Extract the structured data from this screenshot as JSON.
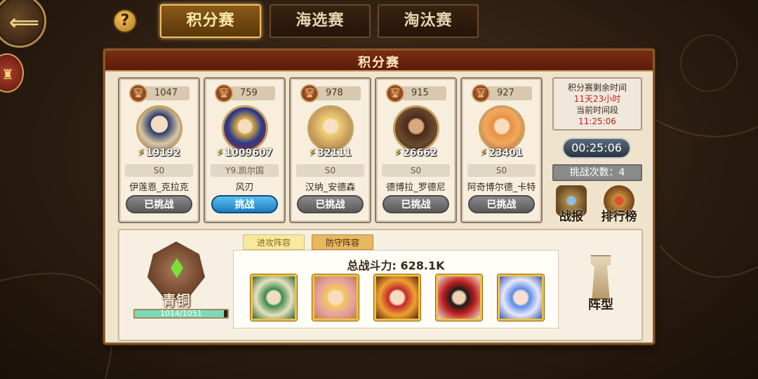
{
  "nav": {
    "help_label": "?",
    "tabs": [
      {
        "label": "积分赛",
        "active": true
      },
      {
        "label": "海选赛",
        "active": false
      },
      {
        "label": "淘汰赛",
        "active": false
      }
    ]
  },
  "panel": {
    "title": "积分赛"
  },
  "opponents": [
    {
      "trophy": "1047",
      "power": "19192",
      "server": "S0",
      "name": "伊莲恩_克拉克",
      "button": "已挑战",
      "state": "done"
    },
    {
      "trophy": "759",
      "power": "1009607",
      "server": "Y9.凯尔国",
      "name": "风刃",
      "button": "挑战",
      "state": "available"
    },
    {
      "trophy": "978",
      "power": "32111",
      "server": "S0",
      "name": "汉纳_安德森",
      "button": "已挑战",
      "state": "done"
    },
    {
      "trophy": "915",
      "power": "26662",
      "server": "S0",
      "name": "德博拉_罗德尼",
      "button": "已挑战",
      "state": "done"
    },
    {
      "trophy": "927",
      "power": "23401",
      "server": "S0",
      "name": "阿奇博尔德_卡特",
      "button": "已挑战",
      "state": "done"
    }
  ],
  "info": {
    "remaining_label": "积分赛剩余时间",
    "remaining_value": "11天23小时",
    "period_label": "当前时间段",
    "period_value": "11:25:06",
    "countdown": "00:25:06",
    "tries": "挑战次数：4"
  },
  "tools": {
    "report": "战报",
    "rank": "排行榜"
  },
  "player": {
    "rank_name": "青铜",
    "progress_text": "1014/1051",
    "progress_fraction": 0.965
  },
  "lineup": {
    "attack_tab": "进攻阵容",
    "defense_tab": "防守阵容",
    "total_power": "总战斗力:  628.1K",
    "formation": "阵型"
  },
  "colors": {
    "accent_gold": "#f0c060",
    "challenge_blue": "#1e7ac0",
    "red_text": "#c0201a"
  }
}
